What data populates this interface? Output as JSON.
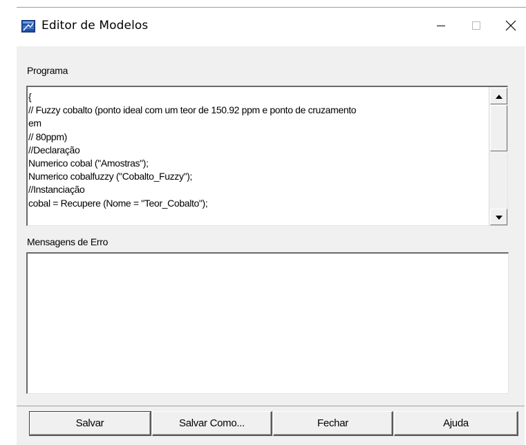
{
  "window": {
    "title": "Editor de Modelos",
    "icon": "model-editor-app-icon",
    "controls": {
      "minimize_icon": "minimize-icon",
      "maximize_icon": "maximize-icon",
      "close_icon": "close-icon"
    }
  },
  "program": {
    "label": "Programa",
    "lines": [
      "{",
      "// Fuzzy cobalto (ponto ideal com um teor de 150.92 ppm e ponto de cruzamento",
      "em",
      "// 80ppm)",
      "//Declaração",
      "Numerico cobal (\"Amostras\");",
      "Numerico cobalfuzzy (\"Cobalto_Fuzzy\");",
      "//Instanciação",
      "cobal = Recupere (Nome = \"Teor_Cobalto\");"
    ]
  },
  "errors": {
    "label": "Mensagens de Erro",
    "content": ""
  },
  "buttons": {
    "save": "Salvar",
    "save_as": "Salvar Como...",
    "close": "Fechar",
    "help": "Ajuda"
  },
  "colors": {
    "dialog_background": "#f0f0f0",
    "title_bar": "#ffffff",
    "field_background": "#ffffff"
  }
}
